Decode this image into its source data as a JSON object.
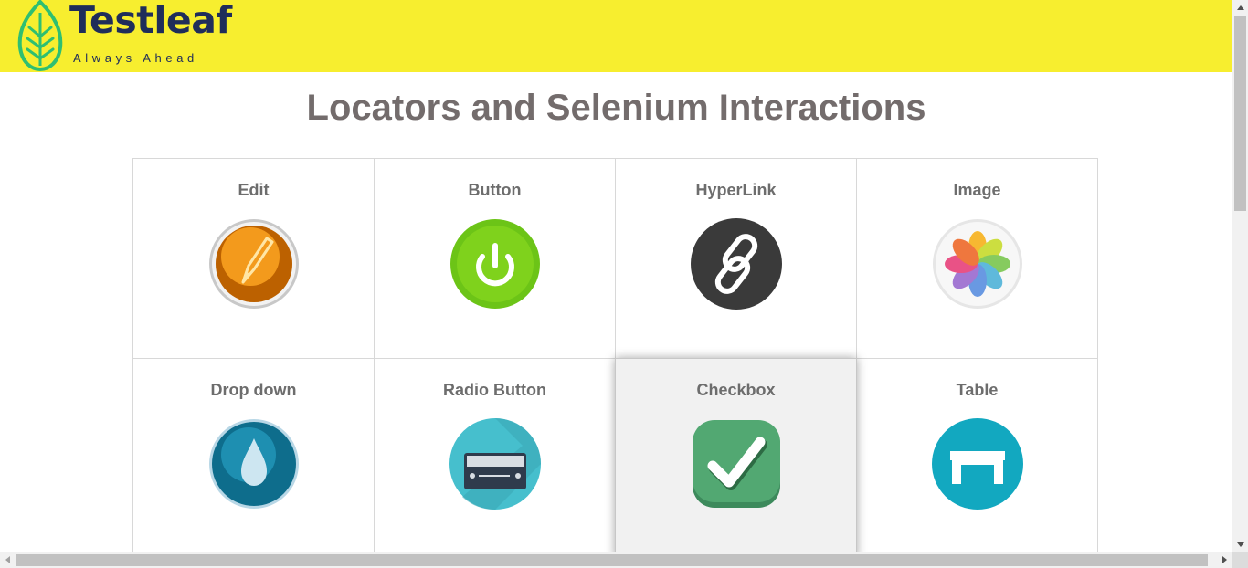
{
  "header": {
    "logo_title": "Testleaf",
    "logo_tagline": "Always Ahead",
    "background": "#f7ee2f",
    "logo_color": "#1f2d5a",
    "leaf_color": "#2fbf71"
  },
  "page_title": "Locators and Selenium Interactions",
  "cards": [
    {
      "label": "Edit",
      "icon": "pencil-icon",
      "active": false
    },
    {
      "label": "Button",
      "icon": "power-button-icon",
      "active": false
    },
    {
      "label": "HyperLink",
      "icon": "chain-link-icon",
      "active": false
    },
    {
      "label": "Image",
      "icon": "photos-flower-icon",
      "active": false
    },
    {
      "label": "Drop down",
      "icon": "water-drop-icon",
      "active": false
    },
    {
      "label": "Radio Button",
      "icon": "radio-receiver-icon",
      "active": false
    },
    {
      "label": "Checkbox",
      "icon": "checkmark-icon",
      "active": true
    },
    {
      "label": "Table",
      "icon": "table-icon",
      "active": false
    }
  ]
}
